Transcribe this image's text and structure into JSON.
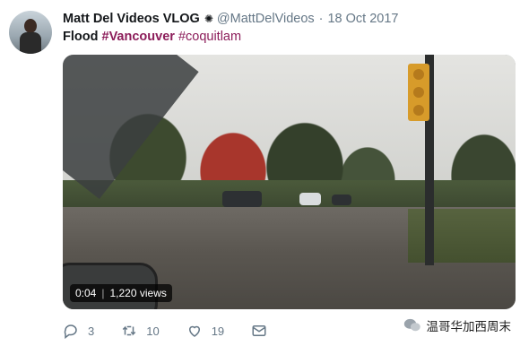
{
  "tweet": {
    "author_name": "Matt Del Videos VLOG",
    "handle": "@MattDelVideos",
    "date": "18 Oct 2017",
    "text_lead": "Flood",
    "hashtags": [
      "#Vancouver",
      "#coquitlam"
    ]
  },
  "video": {
    "duration": "0:04",
    "views": "1,220 views"
  },
  "actions": {
    "replies": "3",
    "retweets": "10",
    "likes": "19"
  },
  "watermark": {
    "text": "温哥华加西周末"
  },
  "colors": {
    "hashtag": "#8c1d5a",
    "meta": "#657786"
  }
}
